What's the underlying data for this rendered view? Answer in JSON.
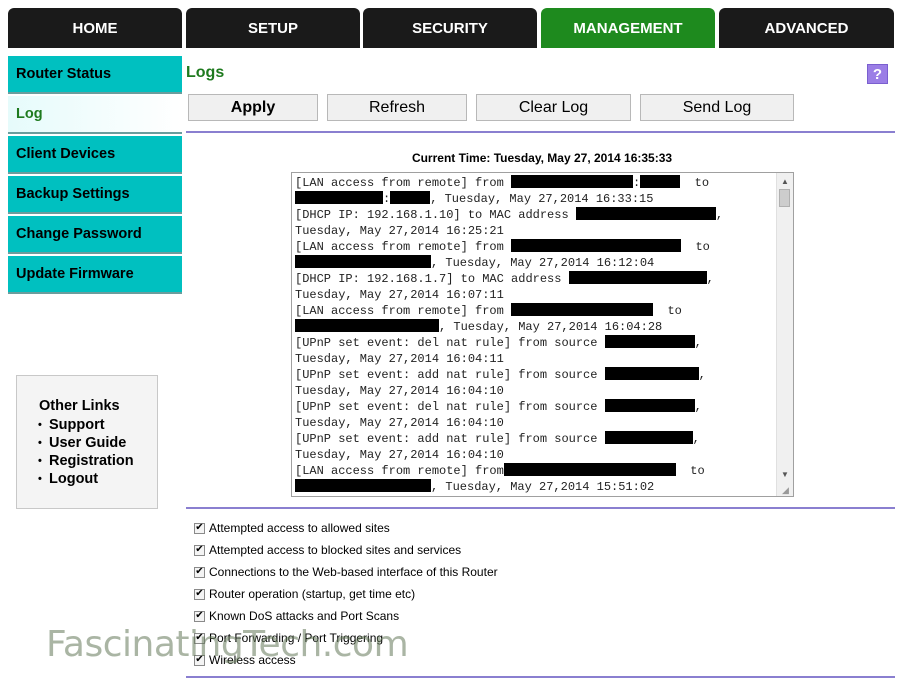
{
  "tabs": [
    "HOME",
    "SETUP",
    "SECURITY",
    "MANAGEMENT",
    "ADVANCED"
  ],
  "sidebar": [
    "Router Status",
    "Log",
    "Client Devices",
    "Backup Settings",
    "Change Password",
    "Update Firmware"
  ],
  "other_links": {
    "title": "Other Links",
    "links": [
      "Support",
      "User Guide",
      "Registration",
      "Logout"
    ]
  },
  "page": {
    "title": "Logs",
    "help_icon": "?",
    "buttons": [
      "Apply",
      "Refresh",
      "Clear Log",
      "Send Log"
    ],
    "current_time": "Current Time: Tuesday, May 27, 2014 16:35:33"
  },
  "log_lines": [
    "[LAN access from remote] from",
    ", Tuesday, May 27,2014 16:33:15",
    "[DHCP IP: 192.168.1.10] to MAC address",
    "Tuesday, May 27,2014 16:25:21",
    "[LAN access from remote] from",
    ", Tuesday, May 27,2014 16:12:04",
    "[DHCP IP: 192.168.1.7] to MAC address",
    "Tuesday, May 27,2014 16:07:11",
    "[LAN access from remote] from",
    ", Tuesday, May 27,2014 16:04:28",
    "[UPnP set event: del nat rule] from source",
    "Tuesday, May 27,2014 16:04:11",
    "[UPnP set event: add nat rule] from source",
    "Tuesday, May 27,2014 16:04:10",
    "[UPnP set event: del nat rule] from source",
    "Tuesday, May 27,2014 16:04:10",
    "[UPnP set event: add nat rule] from source",
    "Tuesday, May 27,2014 16:04:10",
    "[LAN access from remote] from",
    ", Tuesday, May 27,2014 15:51:02"
  ],
  "log_options": [
    {
      "label": "Attempted access to allowed sites",
      "checked": true
    },
    {
      "label": "Attempted access to blocked sites and services",
      "checked": true
    },
    {
      "label": "Connections to the Web-based interface of this Router",
      "checked": true
    },
    {
      "label": "Router operation (startup, get time etc)",
      "checked": true
    },
    {
      "label": "Known DoS attacks and Port Scans",
      "checked": true
    },
    {
      "label": "Port Forwarding / Port Triggering",
      "checked": true
    },
    {
      "label": "Wireless access",
      "checked": true
    }
  ],
  "watermark": "FascinatingTech.com",
  "colors": {
    "tab": "#1a1a1a",
    "tab_active": "#1e8a1e",
    "sidebar": "#00c0c0",
    "accent_green": "#1e7a1e",
    "rule": "#8a7fd0"
  }
}
